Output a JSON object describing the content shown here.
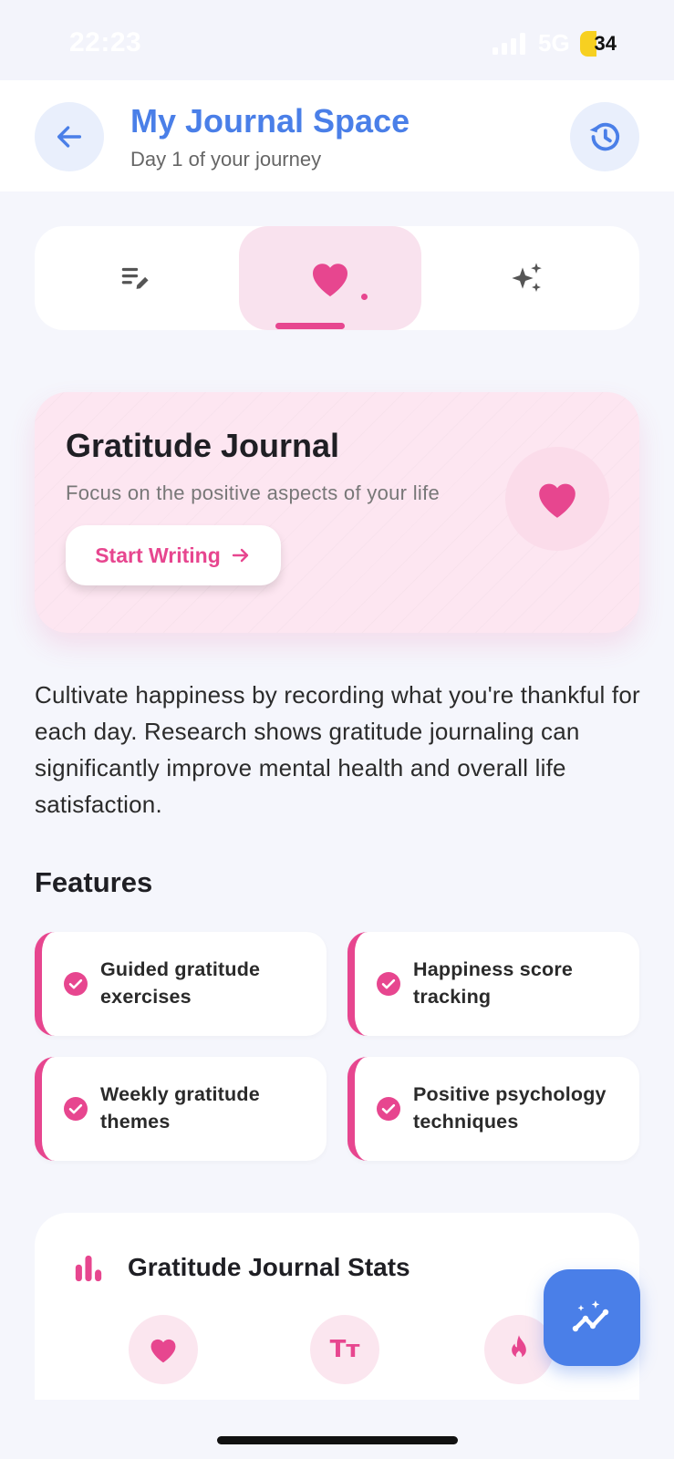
{
  "status_bar": {
    "time": "22:23",
    "network": "5G",
    "battery": "34"
  },
  "header": {
    "title": "My Journal Space",
    "subtitle": "Day 1 of your journey",
    "back_icon": "arrow-left-icon",
    "history_icon": "history-icon"
  },
  "tabs": [
    {
      "icon": "edit-notes-icon",
      "selected": false
    },
    {
      "icon": "heart-icon",
      "selected": true
    },
    {
      "icon": "sparkles-icon",
      "selected": false
    }
  ],
  "hero": {
    "title": "Gratitude Journal",
    "subtitle": "Focus on the positive aspects of your life",
    "button_label": "Start Writing",
    "button_icon": "arrow-right-icon",
    "icon": "heart-icon"
  },
  "description": "Cultivate happiness by recording what you're thankful for each day. Research shows gratitude journaling can significantly improve mental health and overall life satisfaction.",
  "features": {
    "title": "Features",
    "items": [
      "Guided gratitude exercises",
      "Happiness score tracking",
      "Weekly gratitude themes",
      "Positive psychology techniques"
    ]
  },
  "stats": {
    "title": "Gratitude Journal Stats",
    "icons": [
      "heart-icon",
      "text-size-icon",
      "fire-icon"
    ],
    "text_size_glyph": "Tт"
  },
  "fab": {
    "icon": "insights-icon"
  },
  "colors": {
    "accent_pink": "#e7468f",
    "accent_blue": "#4a7fe8",
    "background": "#f5f6fc"
  }
}
